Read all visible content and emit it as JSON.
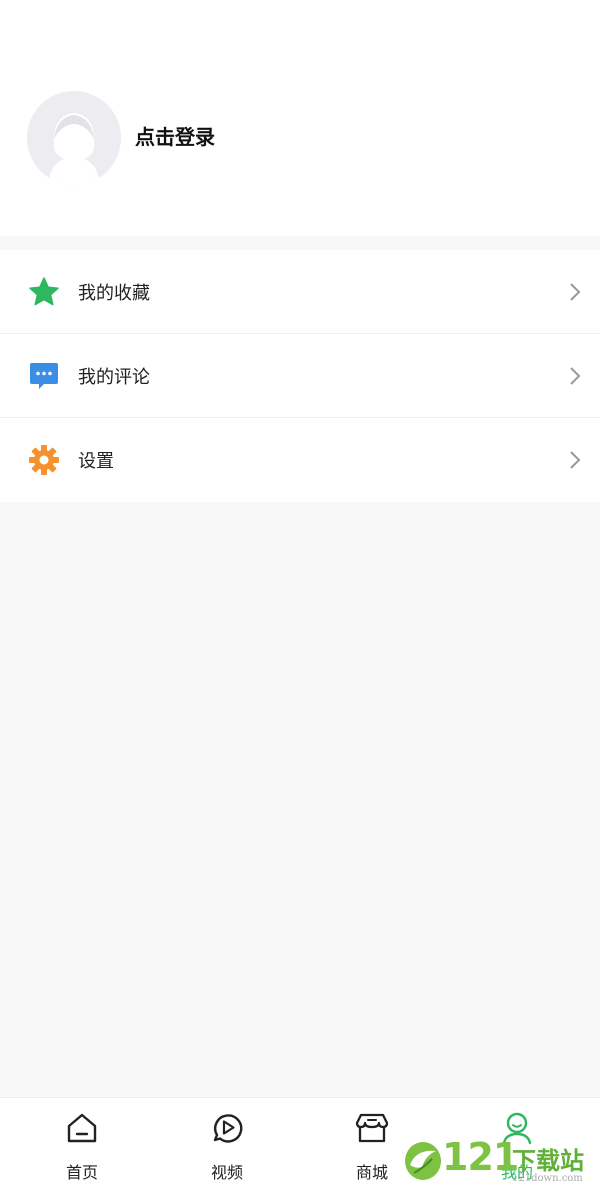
{
  "profile": {
    "login_text": "点击登录"
  },
  "menu": {
    "items": [
      {
        "label": "我的收藏",
        "icon": "star-icon",
        "color": "#2db860"
      },
      {
        "label": "我的评论",
        "icon": "comment-icon",
        "color": "#3a8ee6"
      },
      {
        "label": "设置",
        "icon": "gear-icon",
        "color": "#f5922f"
      }
    ]
  },
  "tabbar": {
    "tabs": [
      {
        "label": "首页",
        "icon": "home-icon"
      },
      {
        "label": "视频",
        "icon": "video-icon"
      },
      {
        "label": "商城",
        "icon": "store-icon"
      },
      {
        "label": "我的",
        "icon": "user-icon",
        "active": true
      }
    ],
    "active_color": "#2db860"
  },
  "watermark": {
    "number": "121",
    "text": "下载站",
    "sub": "121down.com"
  }
}
